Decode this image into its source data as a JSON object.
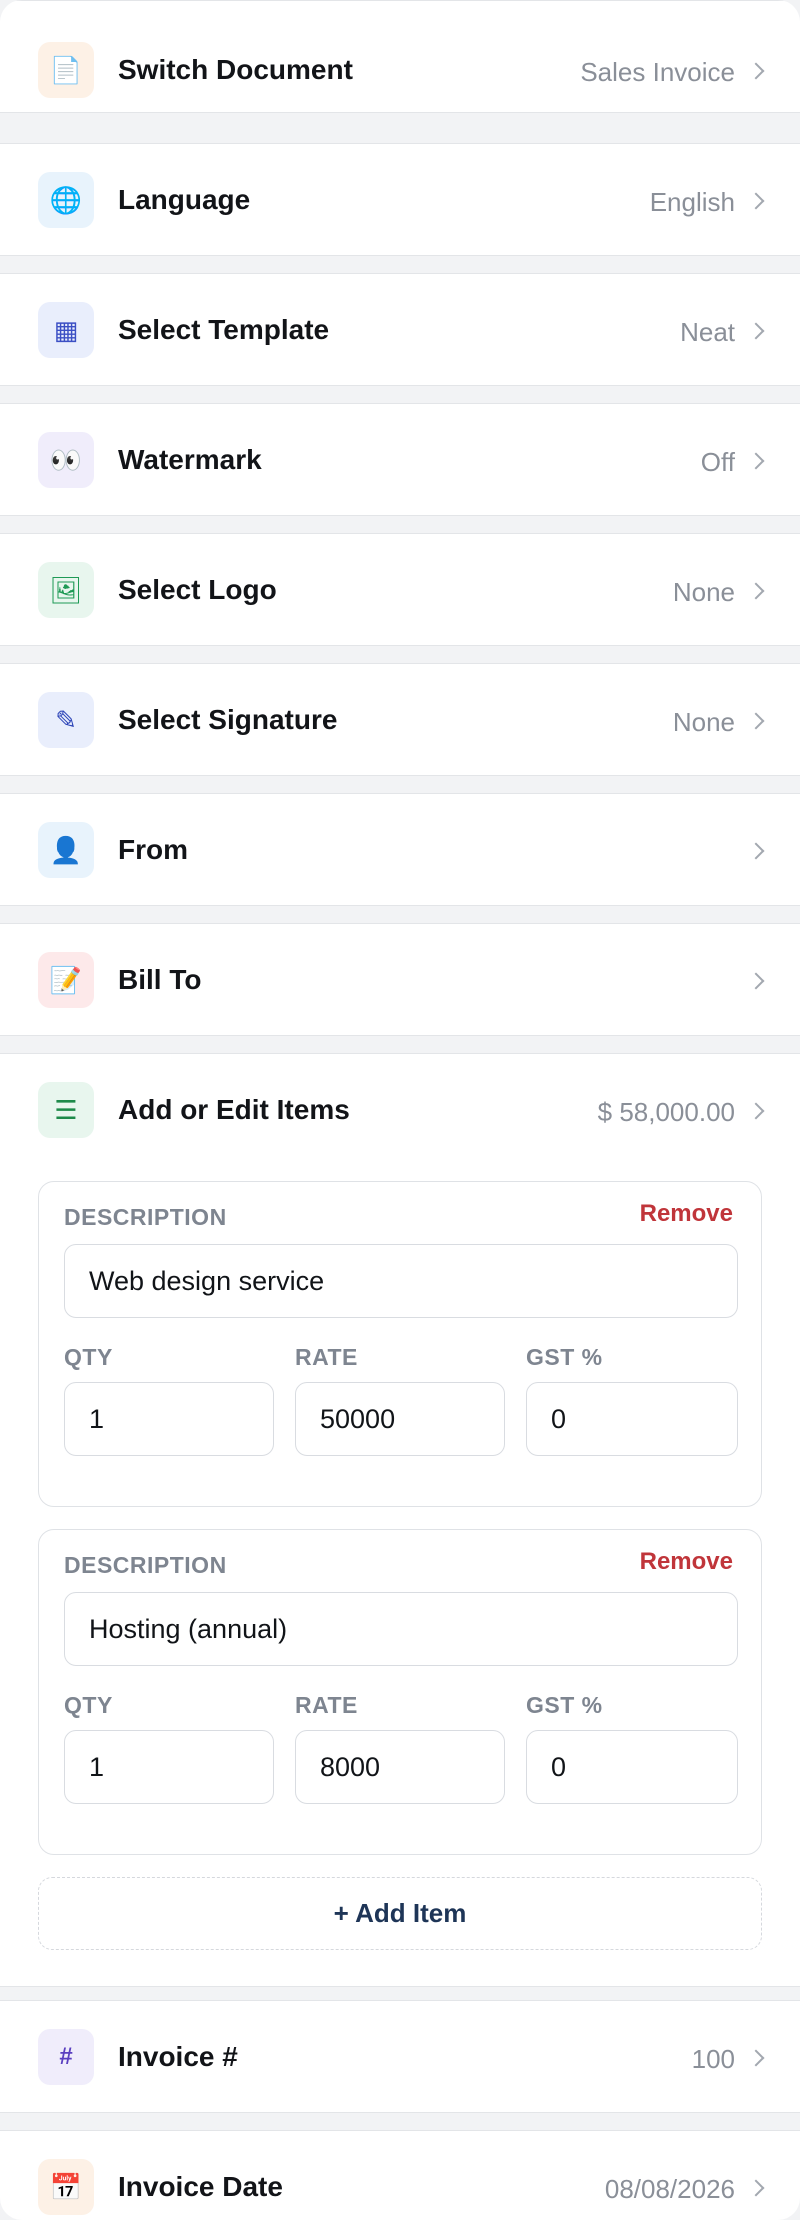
{
  "rows": {
    "switch_document": {
      "label": "Switch Document",
      "value": "Sales Invoice",
      "icon": "📄",
      "icon_bg": "#fdf1e6"
    },
    "language": {
      "label": "Language",
      "value": "English",
      "icon": "🌐",
      "icon_bg": "#e8f3fc"
    },
    "select_template": {
      "label": "Select Template",
      "value": "Neat",
      "icon": "▦",
      "icon_bg": "#e9eefc"
    },
    "watermark": {
      "label": "Watermark",
      "value": "Off",
      "icon": "👀",
      "icon_bg": "#f0edfb"
    },
    "select_logo": {
      "label": "Select Logo",
      "value": "None",
      "icon": "🖼",
      "icon_bg": "#e8f6ee"
    },
    "select_signature": {
      "label": "Select Signature",
      "value": "None",
      "icon": "✎",
      "icon_bg": "#e9eefc"
    },
    "from": {
      "label": "From",
      "value": "",
      "icon": "👤",
      "icon_bg": "#e8f3fc"
    },
    "bill_to": {
      "label": "Bill To",
      "value": "",
      "icon": "📝",
      "icon_bg": "#fde9ea"
    },
    "items": {
      "label": "Add or Edit Items",
      "value": "$ 58,000.00",
      "icon": "☰",
      "icon_bg": "#e8f6ee"
    },
    "invoice_number": {
      "label": "Invoice #",
      "value": "100",
      "icon": "#",
      "icon_bg": "#f0edfb"
    },
    "invoice_date": {
      "label": "Invoice Date",
      "value": "08/08/2026",
      "icon": "📅",
      "icon_bg": "#fdf1e6"
    }
  },
  "item_labels": {
    "description": "DESCRIPTION",
    "qty": "QTY",
    "rate": "RATE",
    "gst": "GST %",
    "remove": "Remove"
  },
  "items": [
    {
      "description": "Web design service",
      "qty": "1",
      "rate": "50000",
      "gst": "0"
    },
    {
      "description": "Hosting (annual)",
      "qty": "1",
      "rate": "8000",
      "gst": "0"
    }
  ],
  "add_item_label": "+ Add Item",
  "colors": {
    "remove": "#c0353a",
    "add_item": "#1e3557",
    "value_gray": "#8a8f98"
  }
}
